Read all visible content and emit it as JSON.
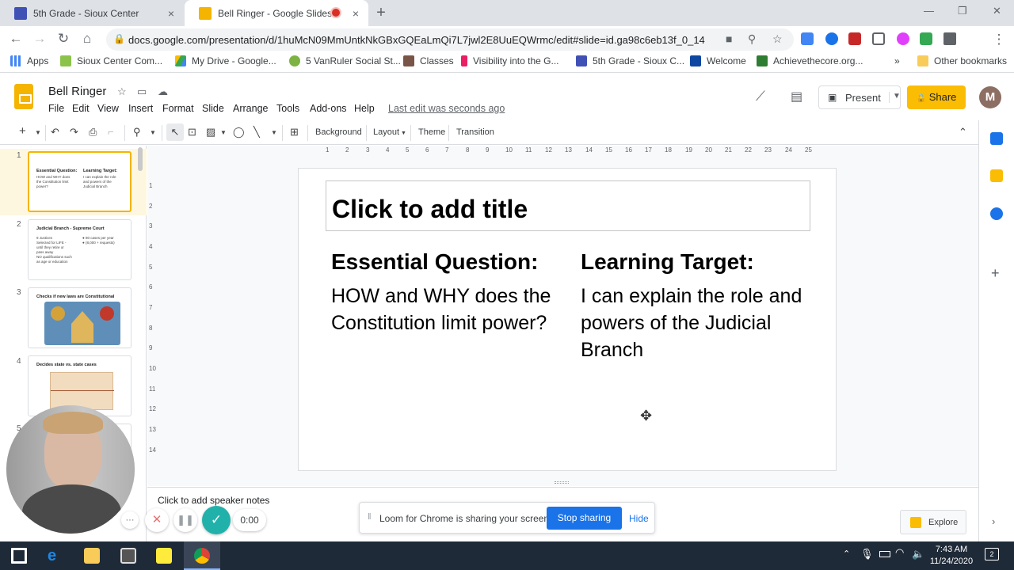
{
  "browser": {
    "tabs": [
      {
        "title": "5th Grade - Sioux Center",
        "close": "×"
      },
      {
        "title": "Bell Ringer - Google Slides",
        "close": "×"
      }
    ],
    "new_tab": "+",
    "window_controls": {
      "minimize": "—",
      "restore": "❐",
      "close": "✕"
    },
    "url": "docs.google.com/presentation/d/1huMcN09MmUntkNkGBxGQEaLmQi7L7jwl2E8UuEQWrmc/edit#slide=id.ga98c6eb13f_0_14",
    "profile_initial": "M",
    "bookmarks": [
      "Apps",
      "Sioux Center Com...",
      "My Drive - Google...",
      "5 VanRuler Social St...",
      "Classes",
      "Visibility into the G...",
      "5th Grade - Sioux C...",
      "Welcome",
      "Achievethecore.org..."
    ],
    "bookmarks_more": "»",
    "other_bookmarks": "Other bookmarks"
  },
  "app": {
    "title": "Bell Ringer",
    "menu": [
      "File",
      "Edit",
      "View",
      "Insert",
      "Format",
      "Slide",
      "Arrange",
      "Tools",
      "Add-ons",
      "Help"
    ],
    "last_edit": "Last edit was seconds ago",
    "present_label": "Present",
    "share_label": "Share",
    "account_initial": "M"
  },
  "toolbar": {
    "background": "Background",
    "layout": "Layout",
    "theme": "Theme",
    "transition": "Transition"
  },
  "filmstrip": {
    "slides": [
      {
        "number": "1",
        "title": "Essential Question:",
        "col1": "HOW and WHY does\nthe Constitution limit\npower?",
        "title2": "Learning Target:",
        "col2": "I can explain the role\nand powers of the\nJudicial Branch"
      },
      {
        "number": "2",
        "title": "Judicial Branch - Supreme Court",
        "col1": "9 Justices\nSelected for LIFE -\nuntil they retire or\npass away\nNO qualifications such\nas age or education",
        "col2": "● 80 cases per year\n● (8,000 + requests)"
      },
      {
        "number": "3",
        "title": "Checks if new laws are Constitutional"
      },
      {
        "number": "4",
        "title": "Decides state vs. state cases"
      },
      {
        "number": "5"
      }
    ]
  },
  "ruler": {
    "h_ticks": [
      "1",
      "2",
      "3",
      "4",
      "5",
      "6",
      "7",
      "8",
      "9",
      "10",
      "11",
      "12",
      "13",
      "14",
      "15",
      "16",
      "17",
      "18",
      "19",
      "20",
      "21",
      "22",
      "23",
      "24",
      "25"
    ],
    "v_ticks": [
      "1",
      "2",
      "3",
      "4",
      "5",
      "6",
      "7",
      "8",
      "9",
      "10",
      "11",
      "12",
      "13",
      "14"
    ]
  },
  "slide": {
    "title_placeholder": "Click to add title",
    "left_heading": "Essential Question:",
    "left_body": "HOW and WHY does the Constitution limit power?",
    "right_heading": "Learning Target:",
    "right_body": "I can explain the role and powers of the Judicial Branch"
  },
  "notes": {
    "placeholder": "Click to add speaker notes"
  },
  "explore": {
    "label": "Explore"
  },
  "loom": {
    "message": "Loom for Chrome is sharing your screen.",
    "stop_label": "Stop sharing",
    "hide_label": "Hide",
    "timer": "0:00"
  },
  "taskbar": {
    "time": "7:43 AM",
    "date": "11/24/2020",
    "notifications": "2"
  },
  "colors": {
    "slides_yellow": "#f4b400",
    "share_yellow": "#fbbc04",
    "loom_blue": "#1a73e8",
    "loom_check": "#20b2aa",
    "selected_thumb_bg": "#fef7e0",
    "taskbar": "#1f2a38"
  }
}
